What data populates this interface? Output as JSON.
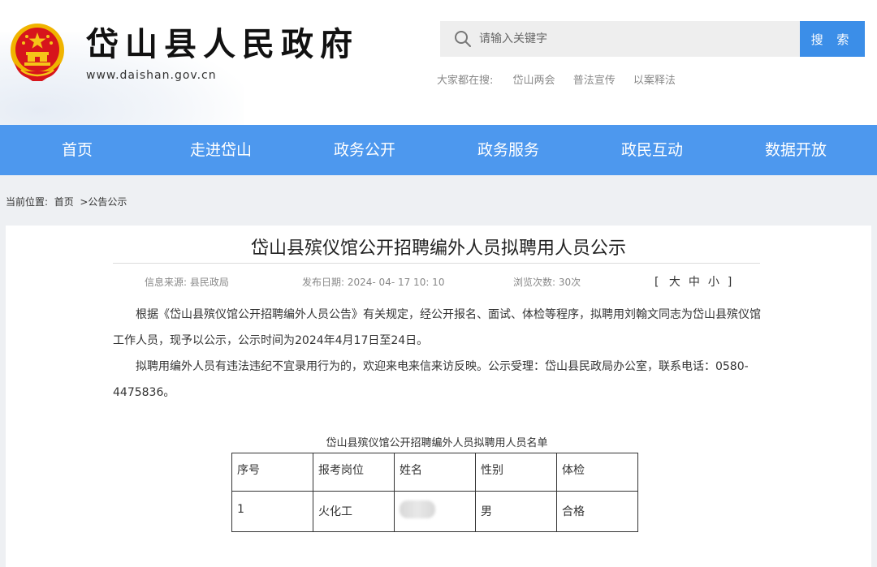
{
  "header": {
    "site_title": "岱山县人民政府",
    "site_url": "www.daishan.gov.cn",
    "emblem_icon": "national-emblem-icon"
  },
  "search": {
    "placeholder": "请输入关键字",
    "button_label": "搜 索",
    "hot_label": "大家都在搜:",
    "hot_terms": [
      "岱山两会",
      "普法宣传",
      "以案释法"
    ]
  },
  "nav": {
    "items": [
      "首页",
      "走进岱山",
      "政务公开",
      "政务服务",
      "政民互动",
      "数据开放"
    ]
  },
  "breadcrumb": {
    "prefix": "当前位置:",
    "home": "首页",
    "current": ">公告公示"
  },
  "article": {
    "title": "岱山县殡仪馆公开招聘编外人员拟聘用人员公示",
    "source_label": "信息来源:",
    "source_value": "县民政局",
    "date_label": "发布日期:",
    "date_value": "2024- 04- 17 10: 10",
    "views_label": "浏览次数:",
    "views_value": "30次",
    "font_size": {
      "open": "[",
      "large": "大",
      "medium": "中",
      "small": "小",
      "close": "]"
    },
    "paragraphs": [
      "根据《岱山县殡仪馆公开招聘编外人员公告》有关规定，经公开报名、面试、体检等程序，拟聘用刘翰文同志为岱山县殡仪馆工作人员，现予以公示，公示时间为2024年4月17日至24日。",
      "拟聘用编外人员有违法违纪不宜录用行为的，欢迎来电来信来访反映。公示受理：岱山县民政局办公室，联系电话：0580-4475836。"
    ]
  },
  "roster": {
    "caption": "岱山县殡仪馆公开招聘编外人员拟聘用人员名单",
    "headers": [
      "序号",
      "报考岗位",
      "姓名",
      "性别",
      "体检"
    ],
    "rows": [
      [
        "1",
        "火化工",
        "",
        "男",
        "合格"
      ]
    ]
  },
  "colors": {
    "nav_bg": "#4d98ee",
    "search_button": "#3b8ee8",
    "emblem_red": "#d7151c",
    "emblem_gold": "#f5c518"
  }
}
